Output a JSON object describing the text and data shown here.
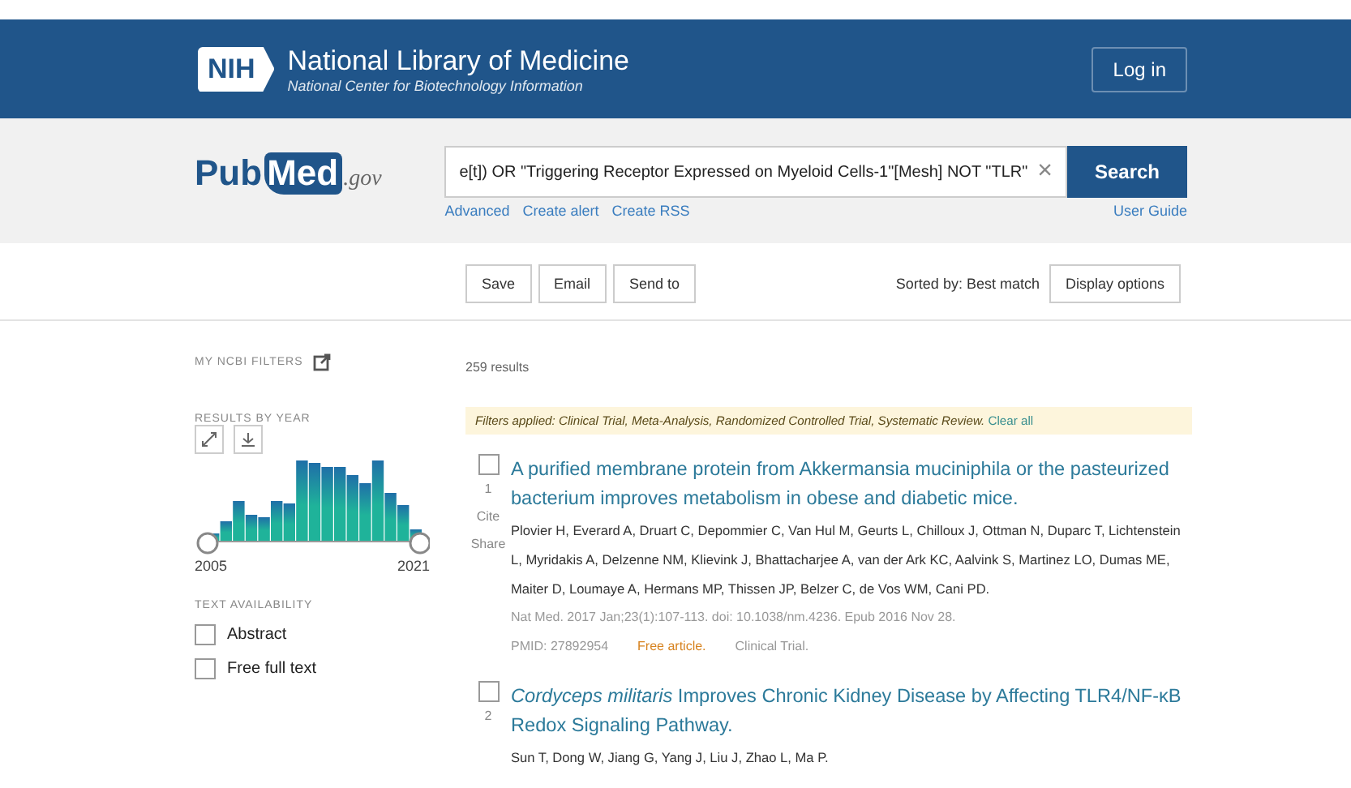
{
  "header": {
    "logo": "NIH",
    "title": "National Library of Medicine",
    "subtitle": "National Center for Biotechnology Information",
    "login": "Log in"
  },
  "search": {
    "logo_pub": "Pub",
    "logo_med": "Med",
    "logo_gov": ".gov",
    "value": "e[t]) OR \"Triggering Receptor Expressed on Myeloid Cells-1\"[Mesh] NOT \"TLR\"",
    "clear": "×",
    "button": "Search",
    "links": [
      "Advanced",
      "Create alert",
      "Create RSS"
    ],
    "user_guide": "User Guide"
  },
  "toolbar": {
    "actions": [
      "Save",
      "Email",
      "Send to"
    ],
    "sort": "Sorted by: Best match",
    "display": "Display options"
  },
  "sidebar": {
    "my_filters": "MY NCBI FILTERS",
    "results_by_year": "RESULTS BY YEAR",
    "year_start": "2005",
    "year_end": "2021",
    "text_availability": "TEXT AVAILABILITY",
    "filters": [
      {
        "label": "Abstract",
        "checked": false
      },
      {
        "label": "Free full text",
        "checked": false
      }
    ]
  },
  "results": {
    "count": "259 results",
    "filters_applied": "Filters applied: Clinical Trial, Meta-Analysis, Randomized Controlled Trial, Systematic Review.",
    "clear_all": "Clear all",
    "items": [
      {
        "number": "1",
        "checked": false,
        "title": "A purified membrane protein from Akkermansia muciniphila or the pasteurized bacterium improves metabolism in obese and diabetic mice.",
        "actions": [
          "Cite",
          "Share"
        ],
        "authors": "Plovier H, Everard A, Druart C, Depommier C, Van Hul M, Geurts L, Chilloux J, Ottman N, Duparc T, Lichtenstein L, Myridakis A, Delzenne NM, Klievink J, Bhattacharjee A, van der Ark KC, Aalvink S, Martinez LO, Dumas ME, Maiter D, Loumaye A, Hermans MP, Thissen JP, Belzer C, de Vos WM, Cani PD.",
        "citation": "Nat Med. 2017 Jan;23(1):107-113. doi: 10.1038/nm.4236. Epub 2016 Nov 28.",
        "pmid": "PMID: 27892954",
        "tags": [
          {
            "text": "Free article.",
            "kind": "free"
          },
          {
            "text": "Clinical Trial.",
            "kind": "type"
          }
        ]
      },
      {
        "number": "2",
        "checked": false,
        "title": "*Cordyceps militaris* Improves Chronic Kidney Disease by Affecting TLR4/NF-κB Redox Signaling Pathway.",
        "authors": "Sun T, Dong W, Jiang G, Yang J, Liu J, Zhao L, Ma P."
      }
    ]
  }
}
